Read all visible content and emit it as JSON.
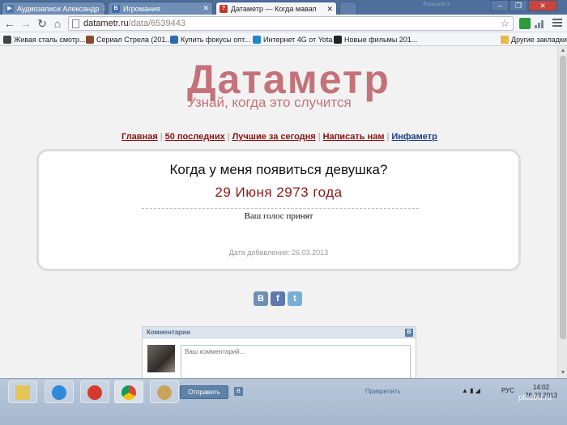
{
  "browser": {
    "tabs": [
      {
        "title": "Аудиозаписи Александр",
        "fav_color": "#4a76a8",
        "fav_letter": "▶",
        "active": false
      },
      {
        "title": "Игромания",
        "fav_color": "#3d6eb5",
        "fav_letter": "В",
        "active": false
      },
      {
        "title": "Датаметр — Когда мавап",
        "fav_color": "#c0392b",
        "fav_letter": "?",
        "active": true
      }
    ],
    "url_host": "datametr.ru",
    "url_path": "/data/6539443",
    "bookmarks": [
      {
        "label": "Живая сталь смотр...",
        "color": "#444"
      },
      {
        "label": "Сериал Стрела (201...",
        "color": "#8a4b2b"
      },
      {
        "label": "Купить фокусы опт...",
        "color": "#2d6bb0"
      },
      {
        "label": "Интернет 4G от Yota",
        "color": "#1e88c8"
      },
      {
        "label": "Новые фильмы 201...",
        "color": "#222"
      }
    ],
    "bookmarks_folder": "Другие закладки"
  },
  "site": {
    "logo": "Датаметр",
    "tagline": "Узнай, когда это случится",
    "nav": [
      "Главная",
      "50 последних",
      "Лучшие за сегодня",
      "Написать нам",
      "Инфаметр"
    ],
    "question": "Когда у меня появиться девушка?",
    "answer": "29 Июня 2973 года",
    "vote_status": "Ваш голос принят",
    "date_added": "Дата добавления: 26.03.2013"
  },
  "share": {
    "vk": "В",
    "fb": "f",
    "tw": "t"
  },
  "comments": {
    "header": "Комментарии",
    "placeholder": "Ваш комментарий...",
    "send_label": "Отправить",
    "attach_label": "Прикрепить",
    "vk_badge": "В"
  },
  "taskbar": {
    "lang": "РУС",
    "clock_time": "14:02",
    "clock_date": "26.03.2013",
    "watermark": "pikabu.ru"
  }
}
